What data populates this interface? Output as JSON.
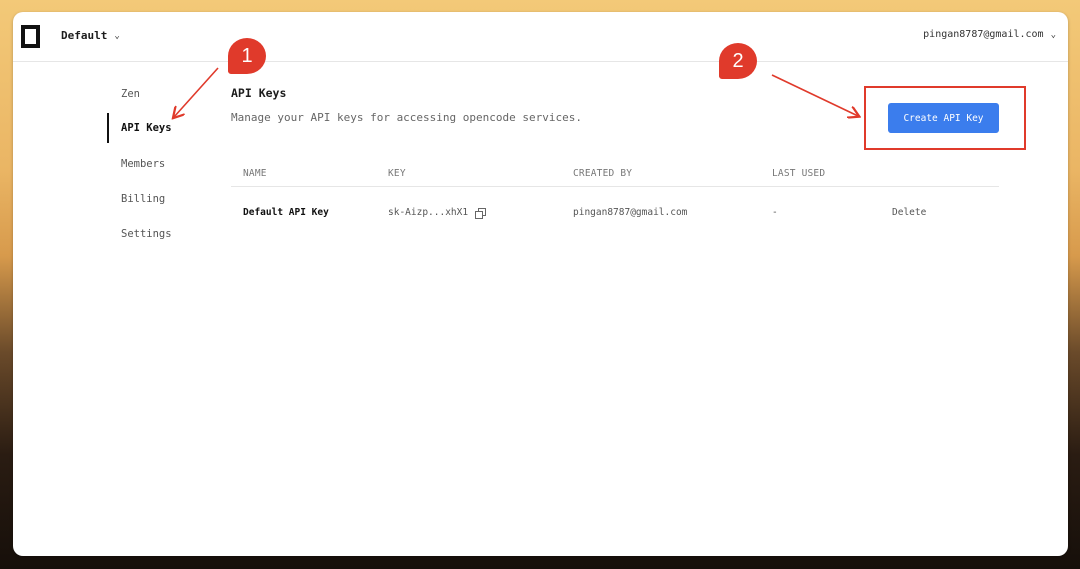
{
  "header": {
    "workspace_label": "Default",
    "account_email": "pingan8787@gmail.com"
  },
  "sidebar": {
    "items": [
      {
        "label": "Zen"
      },
      {
        "label": "API Keys"
      },
      {
        "label": "Members"
      },
      {
        "label": "Billing"
      },
      {
        "label": "Settings"
      }
    ],
    "active_index": 1
  },
  "main": {
    "title": "API Keys",
    "subtitle": "Manage your API keys for accessing opencode services.",
    "create_button_label": "Create API Key"
  },
  "table": {
    "columns": [
      "NAME",
      "KEY",
      "CREATED BY",
      "LAST USED"
    ],
    "rows": [
      {
        "name": "Default API Key",
        "key": "sk-Aizp...xhX1",
        "created_by": "pingan8787@gmail.com",
        "last_used": "-",
        "action": "Delete"
      }
    ]
  },
  "annotations": {
    "badge_1": "1",
    "badge_2": "2",
    "color": "#e03a2b"
  },
  "colors": {
    "accent": "#3b7ded"
  },
  "icons": {
    "logo": "logo-square-icon",
    "dropdown": "chevron-down-icon",
    "copy": "copy-icon"
  }
}
